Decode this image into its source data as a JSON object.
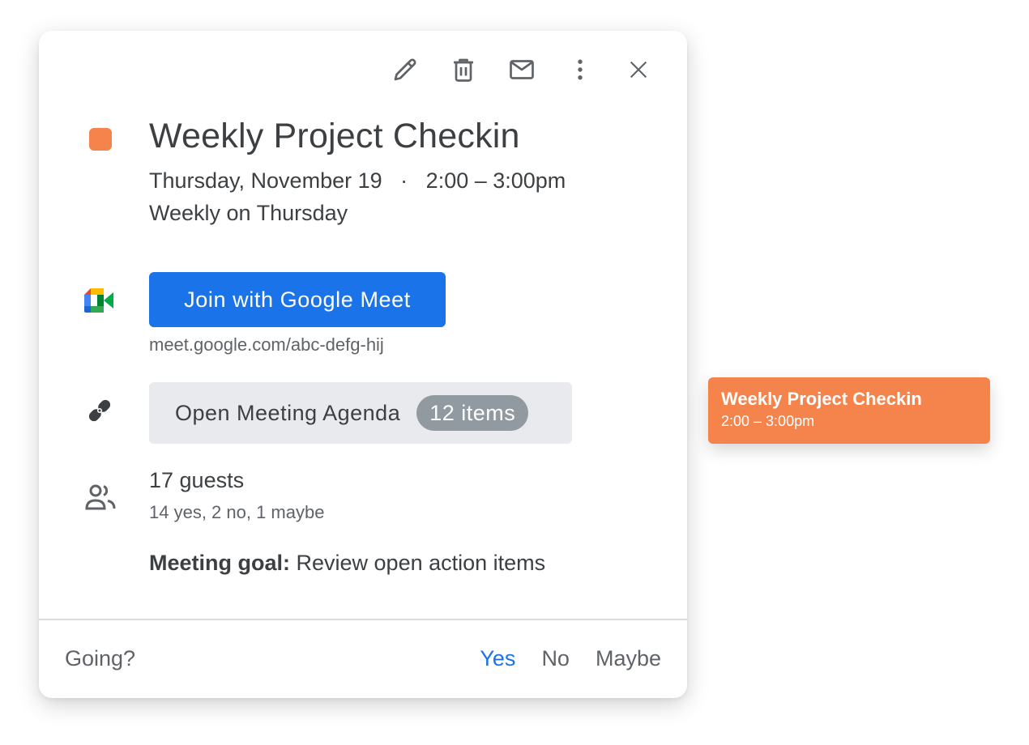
{
  "toolbar": {
    "icons": [
      "edit-icon",
      "delete-icon",
      "email-icon",
      "more-options-icon",
      "close-icon"
    ]
  },
  "event": {
    "color": "#f5844c",
    "title": "Weekly Project Checkin",
    "date": "Thursday, November 19",
    "separator": "·",
    "time": "2:00 – 3:00pm",
    "recurrence": "Weekly on Thursday"
  },
  "meet": {
    "button_label": "Join with Google Meet",
    "link": "meet.google.com/abc-defg-hij",
    "accent": "#1a73e8"
  },
  "agenda": {
    "label": "Open Meeting Agenda",
    "badge": "12 items"
  },
  "guests": {
    "count_label": "17 guests",
    "summary": "14 yes, 2 no, 1 maybe"
  },
  "goal": {
    "label": "Meeting goal:",
    "text": "Review open action items"
  },
  "footer": {
    "going_label": "Going?",
    "options": [
      "Yes",
      "No",
      "Maybe"
    ],
    "selected": "Yes"
  },
  "chip": {
    "title": "Weekly Project Checkin",
    "time": "2:00 – 3:00pm",
    "color": "#f5844c"
  }
}
